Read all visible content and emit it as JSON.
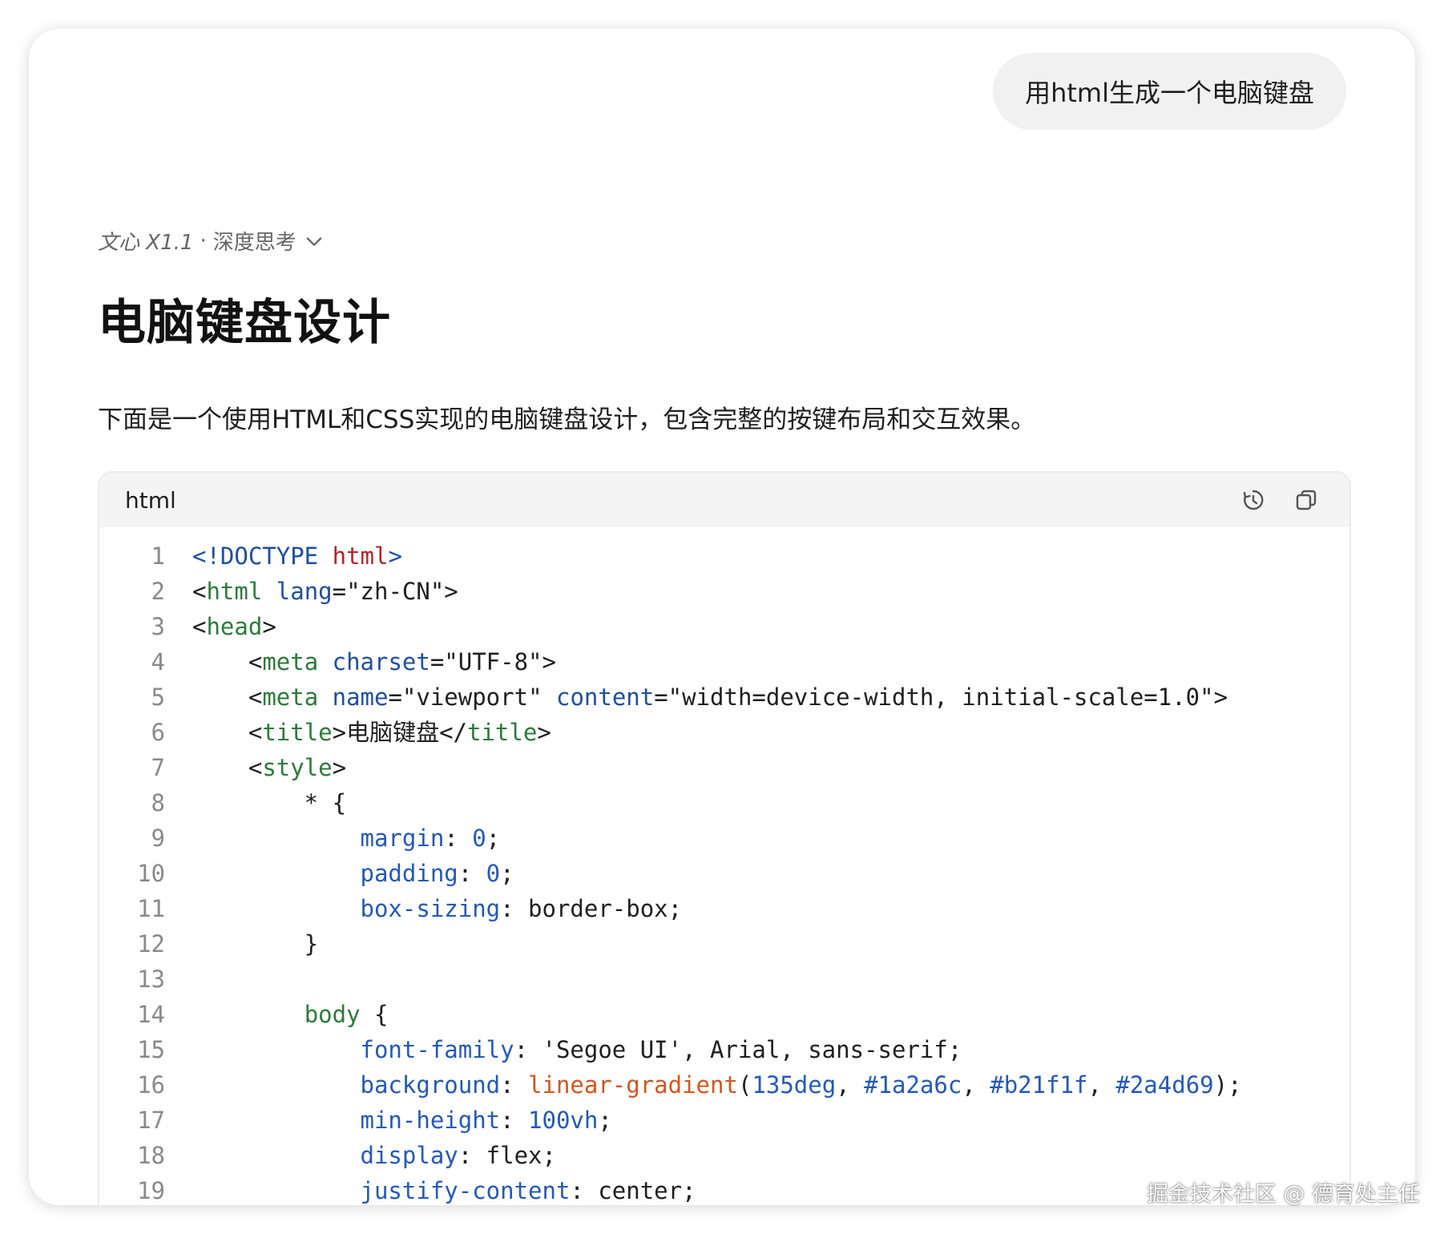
{
  "user_message": "用html生成一个电脑键盘",
  "model": {
    "name": "文心 X1.1",
    "separator": "·",
    "mode": "深度思考"
  },
  "answer": {
    "title": "电脑键盘设计",
    "intro": "下面是一个使用HTML和CSS实现的电脑键盘设计，包含完整的按键布局和交互效果。"
  },
  "code_block": {
    "language": "html",
    "actions": [
      "run-icon",
      "copy-icon"
    ],
    "lines": [
      {
        "n": "1",
        "tokens": [
          {
            "t": "<!DOCTYPE ",
            "c": "kw"
          },
          {
            "t": "html",
            "c": "red"
          },
          {
            "t": ">",
            "c": "kw"
          }
        ]
      },
      {
        "n": "2",
        "tokens": [
          {
            "t": "<",
            "c": "punct"
          },
          {
            "t": "html",
            "c": "tag"
          },
          {
            "t": " ",
            "c": "punct"
          },
          {
            "t": "lang",
            "c": "attr"
          },
          {
            "t": "=\"zh-CN\">",
            "c": "str"
          }
        ]
      },
      {
        "n": "3",
        "tokens": [
          {
            "t": "<",
            "c": "punct"
          },
          {
            "t": "head",
            "c": "tag"
          },
          {
            "t": ">",
            "c": "punct"
          }
        ]
      },
      {
        "n": "4",
        "tokens": [
          {
            "t": "    <",
            "c": "punct"
          },
          {
            "t": "meta",
            "c": "tag"
          },
          {
            "t": " ",
            "c": "punct"
          },
          {
            "t": "charset",
            "c": "attr"
          },
          {
            "t": "=\"UTF-8\">",
            "c": "str"
          }
        ]
      },
      {
        "n": "5",
        "tokens": [
          {
            "t": "    <",
            "c": "punct"
          },
          {
            "t": "meta",
            "c": "tag"
          },
          {
            "t": " ",
            "c": "punct"
          },
          {
            "t": "name",
            "c": "attr"
          },
          {
            "t": "=\"viewport\" ",
            "c": "str"
          },
          {
            "t": "content",
            "c": "attr"
          },
          {
            "t": "=\"width=device-width, initial-scale=1.0\">",
            "c": "str"
          }
        ]
      },
      {
        "n": "6",
        "tokens": [
          {
            "t": "    <",
            "c": "punct"
          },
          {
            "t": "title",
            "c": "tag"
          },
          {
            "t": ">电脑键盘</",
            "c": "punct"
          },
          {
            "t": "title",
            "c": "tag"
          },
          {
            "t": ">",
            "c": "punct"
          }
        ]
      },
      {
        "n": "7",
        "tokens": [
          {
            "t": "    <",
            "c": "punct"
          },
          {
            "t": "style",
            "c": "tag"
          },
          {
            "t": ">",
            "c": "punct"
          }
        ]
      },
      {
        "n": "8",
        "tokens": [
          {
            "t": "        * {",
            "c": "punct"
          }
        ]
      },
      {
        "n": "9",
        "tokens": [
          {
            "t": "            ",
            "c": "punct"
          },
          {
            "t": "margin",
            "c": "prop"
          },
          {
            "t": ": ",
            "c": "punct"
          },
          {
            "t": "0",
            "c": "num"
          },
          {
            "t": ";",
            "c": "punct"
          }
        ]
      },
      {
        "n": "10",
        "tokens": [
          {
            "t": "            ",
            "c": "punct"
          },
          {
            "t": "padding",
            "c": "prop"
          },
          {
            "t": ": ",
            "c": "punct"
          },
          {
            "t": "0",
            "c": "num"
          },
          {
            "t": ";",
            "c": "punct"
          }
        ]
      },
      {
        "n": "11",
        "tokens": [
          {
            "t": "            ",
            "c": "punct"
          },
          {
            "t": "box-sizing",
            "c": "prop"
          },
          {
            "t": ": border-box;",
            "c": "punct"
          }
        ]
      },
      {
        "n": "12",
        "tokens": [
          {
            "t": "        }",
            "c": "punct"
          }
        ]
      },
      {
        "n": "13",
        "tokens": []
      },
      {
        "n": "14",
        "tokens": [
          {
            "t": "        ",
            "c": "punct"
          },
          {
            "t": "body",
            "c": "tag"
          },
          {
            "t": " {",
            "c": "punct"
          }
        ]
      },
      {
        "n": "15",
        "tokens": [
          {
            "t": "            ",
            "c": "punct"
          },
          {
            "t": "font-family",
            "c": "prop"
          },
          {
            "t": ": 'Segoe UI', Arial, sans-serif;",
            "c": "punct"
          }
        ]
      },
      {
        "n": "16",
        "tokens": [
          {
            "t": "            ",
            "c": "punct"
          },
          {
            "t": "background",
            "c": "prop"
          },
          {
            "t": ": ",
            "c": "punct"
          },
          {
            "t": "linear-gradient",
            "c": "fn"
          },
          {
            "t": "(",
            "c": "punct"
          },
          {
            "t": "135deg",
            "c": "num"
          },
          {
            "t": ", ",
            "c": "punct"
          },
          {
            "t": "#1a2a6c",
            "c": "num"
          },
          {
            "t": ", ",
            "c": "punct"
          },
          {
            "t": "#b21f1f",
            "c": "num"
          },
          {
            "t": ", ",
            "c": "punct"
          },
          {
            "t": "#2a4d69",
            "c": "num"
          },
          {
            "t": ");",
            "c": "punct"
          }
        ]
      },
      {
        "n": "17",
        "tokens": [
          {
            "t": "            ",
            "c": "punct"
          },
          {
            "t": "min-height",
            "c": "prop"
          },
          {
            "t": ": ",
            "c": "punct"
          },
          {
            "t": "100vh",
            "c": "num"
          },
          {
            "t": ";",
            "c": "punct"
          }
        ]
      },
      {
        "n": "18",
        "tokens": [
          {
            "t": "            ",
            "c": "punct"
          },
          {
            "t": "display",
            "c": "prop"
          },
          {
            "t": ": flex;",
            "c": "punct"
          }
        ]
      },
      {
        "n": "19",
        "tokens": [
          {
            "t": "            ",
            "c": "punct"
          },
          {
            "t": "justify-content",
            "c": "prop"
          },
          {
            "t": ": center;",
            "c": "punct"
          }
        ]
      }
    ]
  },
  "watermark": "掘金技术社区 @ 德育处主任"
}
